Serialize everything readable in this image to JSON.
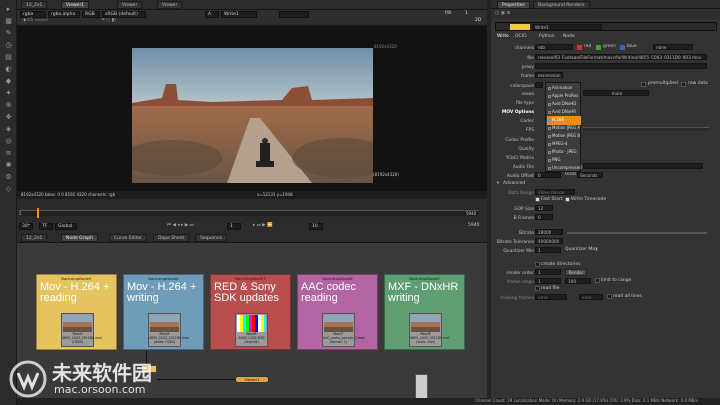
{
  "top_tabs": {
    "left": "12_2v1",
    "viewer1": "Viewer1",
    "viewer": "Viewer",
    "viewer2": "Viewer"
  },
  "viewer_toolbar": {
    "channels": "rgba",
    "alpha": "rgba.alpha",
    "space": "RGB",
    "colorspace": "sRGB (default)",
    "input_a": "A",
    "write": "Write1",
    "gamma": "f/8",
    "zoom": "1",
    "fps": "2D"
  },
  "viewer_info": {
    "format": "8192x4320",
    "bottom_left": "8192x4320 bbox: 0 0 8192 4320 channels: rgb",
    "coords": "x=12131 y=1948",
    "corner": "(8192x4320)",
    "frame_label": "8192x4320"
  },
  "timeline": {
    "fps": "30*",
    "tf": "TF",
    "global": "Global",
    "frame": "1",
    "incr": "10",
    "start": "5",
    "end": "5940",
    "end2": "5940"
  },
  "bottom_tabs": [
    "12_2v1",
    "Node Graph",
    "Curve Editor",
    "Dope Sheet",
    "Sequence"
  ],
  "backdrops": [
    {
      "label": "BackdropNode5",
      "title": "Mov - H.264 + reading",
      "color": "#e5c460",
      "read": "Read4",
      "file": "4855_C003_0311D0.mov",
      "sub": "(H264)",
      "thumb": "t1"
    },
    {
      "label": "BackdropNode6",
      "title": "Mov - H.264 + writing",
      "color": "#6e9cb9",
      "read": "Read5",
      "file": "4855_C003_0311D0.mov",
      "sub": "(write: H264)",
      "thumb": "t2"
    },
    {
      "label": "BackdropNode7",
      "title": "RED & Sony SDK updates",
      "color": "#b94e4e",
      "read": "Read6",
      "file": "A000_C002.R3D",
      "sub": "(red/r3d)",
      "thumb": "t3"
    },
    {
      "label": "BackdropNode8",
      "title": "AAC codec reading",
      "color": "#b364a3",
      "read": "Read7",
      "file": "AAC_audio_sample_2.mov",
      "sub": "(format: 1)",
      "thumb": "t4"
    },
    {
      "label": "BackdropNode9",
      "title": "MXF - DNxHR writing",
      "color": "#5e9e72",
      "read": "Read8",
      "file": "4855_C003_0311D0.mxf",
      "sub": "(write: mxf)",
      "thumb": "t5"
    }
  ],
  "graph_nodes": {
    "viewer_node": "Viewer1",
    "write_node": "Write1"
  },
  "properties": {
    "tabs": [
      "Properties",
      "Background Renders"
    ],
    "node_name": "Write1",
    "subtabs": [
      "Write",
      "OCIO",
      "Python",
      "Node"
    ],
    "channels": "rgb",
    "red": "red",
    "green": "green",
    "blue": "blue",
    "none": "none",
    "file": "release/03_Footage/FileFormat/movs/forWriting/4855_C003_0311D0_003.mov",
    "proxy": "",
    "frame": "expression",
    "colorspace": "default",
    "premultiplied": "premultiplied",
    "raw_data": "raw data",
    "views": "main",
    "file_type": "mov",
    "labels": {
      "channels": "channels",
      "file": "file",
      "proxy": "proxy",
      "frame": "frame",
      "colorspace": "colorspace",
      "views": "views",
      "file_type": "file type",
      "mov_options": "MOV Options",
      "codec": "Codec",
      "fps": "FPS",
      "codec_profile": "Codec Profile",
      "quality": "Quality",
      "ycbcr": "YCbCr Matrix",
      "audio_file": "Audio File",
      "audio_offset": "Audio Offset",
      "units": "Units",
      "advanced": "Advanced",
      "data_range": "Data Range",
      "fast_start": "Fast Start",
      "write_timecode": "Write Timecode",
      "gop": "GOP Size",
      "bframes": "B Frames",
      "bitrate": "Bitrate",
      "bitrate_tol": "Bitrate Tolerance",
      "quantizer_min": "Quantizer Min",
      "quantizer_max": "Quantizer Max",
      "create_dirs": "create directories",
      "render_order": "render order",
      "frame_range": "frame range",
      "read_file": "read file",
      "missing_frames": "missing frames",
      "read_all_lines": "read all lines",
      "limit_range": "limit to range",
      "render": "Render"
    },
    "audio_offset": "0",
    "units": "Seconds",
    "data_range": "Video Range",
    "gop": "12",
    "bframes": "0",
    "bitrate": "28000",
    "bitrate_tol": "40000000",
    "qmin": "1",
    "qmax": "3",
    "render_order": "1",
    "frame_start": "1",
    "frame_end": "100",
    "missing": "error",
    "on_error": "error"
  },
  "codec_dropdown": [
    "Animation",
    "Apple ProRes",
    "Avid DNxHD",
    "Avid DNxHR",
    "H.264",
    "Motion JPEG A",
    "Motion JPEG B",
    "MPEG-4",
    "Photo - JPEG",
    "PNG",
    "Uncompressed"
  ],
  "codec_selected": 4,
  "status_bar": "Channel Count: 19 Localisation Mode: On Memory: 2.9 GB (17.8%) CPU: 2.9% Disk: 0.1 MB/s Network: 0.0 MB/s",
  "watermark": {
    "cn": "未来软件园",
    "url": "mac.orsoon.com"
  },
  "colors": {
    "accent": "#f08a1c",
    "panel": "#333333"
  }
}
